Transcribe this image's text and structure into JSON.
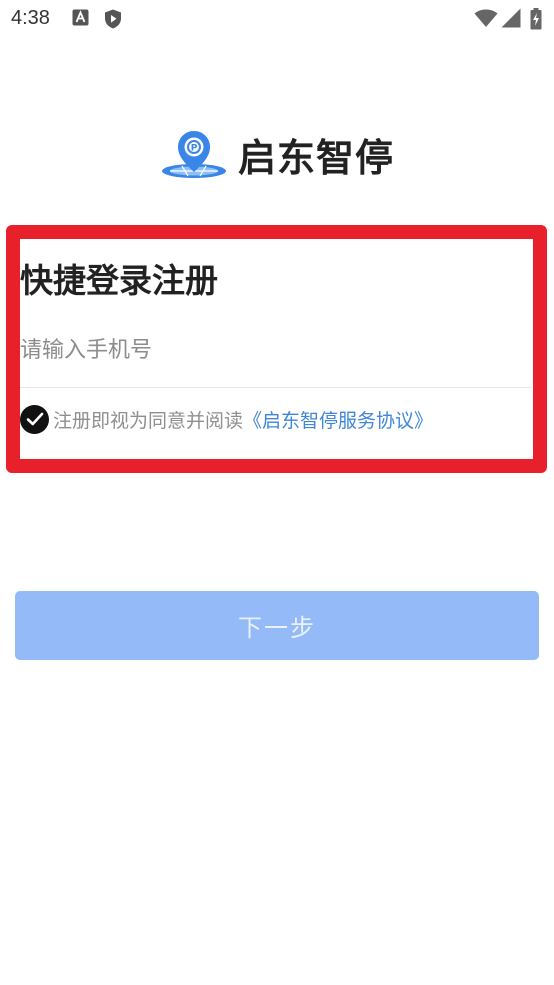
{
  "status_bar": {
    "time": "4:38",
    "icons": [
      "a-notification-icon",
      "shield-play-icon",
      "wifi-icon",
      "signal-icon",
      "battery-charging-icon"
    ]
  },
  "app": {
    "name": "启东智停",
    "logo_icon": "location-pin-globe-icon"
  },
  "login": {
    "title": "快捷登录注册",
    "phone_placeholder": "请输入手机号",
    "phone_value": "",
    "agreement_prefix": "注册即视为同意并阅读",
    "agreement_link": "《启东智停服务协议》",
    "agreed": true
  },
  "actions": {
    "next_label": "下一步"
  },
  "colors": {
    "highlight_border": "#e8202b",
    "button_bg": "#94bbf7",
    "link": "#3f86d8",
    "logo_blue": "#3a86e6"
  }
}
